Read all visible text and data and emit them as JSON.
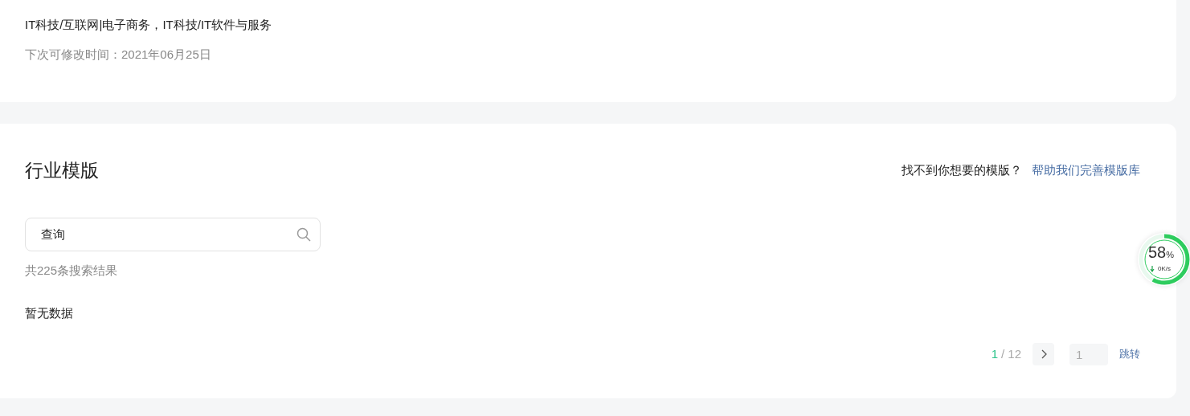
{
  "profile_card": {
    "industry": "IT科技/互联网|电子商务，IT科技/IT软件与服务",
    "next_edit": "下次可修改时间：2021年06月25日"
  },
  "template_card": {
    "title": "行业模版",
    "prompt": "找不到你想要的模版？",
    "help_link": "帮助我们完善模版库",
    "search": {
      "value": "查询"
    },
    "result_count": "共225条搜索结果",
    "empty_text": "暂无数据",
    "pagination": {
      "current": "1",
      "total": "/ 12",
      "jump_value": "1",
      "jump_button": "跳转"
    }
  },
  "speed_widget": {
    "percent": "58",
    "unit": "%",
    "speed": "0K/s",
    "level": 0.58
  }
}
